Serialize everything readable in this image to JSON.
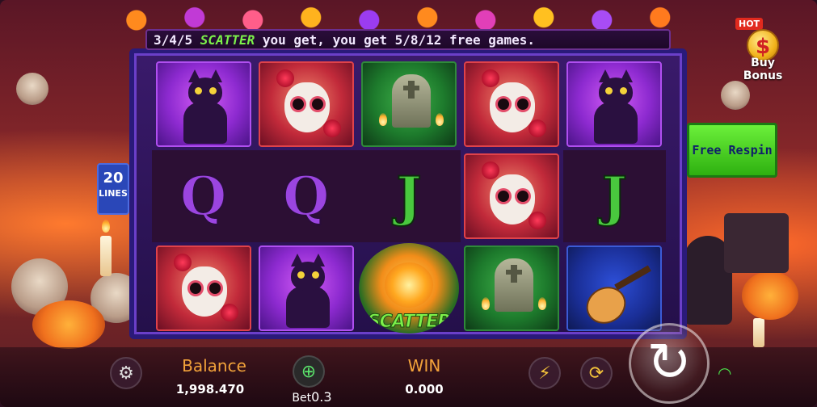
{
  "ticker": {
    "prefix": "3/4/5 ",
    "scatter_word": "SCATTER",
    "suffix": " you get, you get 5/8/12 free games."
  },
  "lines_badge": {
    "number": "20",
    "word": "LINES"
  },
  "buy_bonus": {
    "hot": "HOT",
    "coin": "$",
    "label": "Buy Bonus"
  },
  "free_respin": {
    "label": "Free Respin"
  },
  "reels": [
    [
      "cat",
      "lady",
      "tomb",
      "lady",
      "cat"
    ],
    [
      "Q",
      "Q",
      "J",
      "lady",
      "J"
    ],
    [
      "lady",
      "cat",
      "scatter",
      "tomb",
      "guitar"
    ]
  ],
  "scatter_label": "SCATTER",
  "bottom": {
    "balance_label": "Balance",
    "balance_value": "1,998.470",
    "bet_label": "Bet",
    "bet_value": "0.3",
    "win_label": "WIN",
    "win_value": "0.000"
  },
  "icons": {
    "settings": "gear-icon",
    "bet": "coin-stack-icon",
    "turbo": "lightning-icon",
    "auto": "autoplay-icon",
    "spin": "spin-icon",
    "wifi": "wifi-icon"
  },
  "colors": {
    "accent_orange": "#f2a23a",
    "scatter_green": "#7cf04a",
    "respin_green": "#4fd41f",
    "hot_red": "#e12a1e"
  }
}
